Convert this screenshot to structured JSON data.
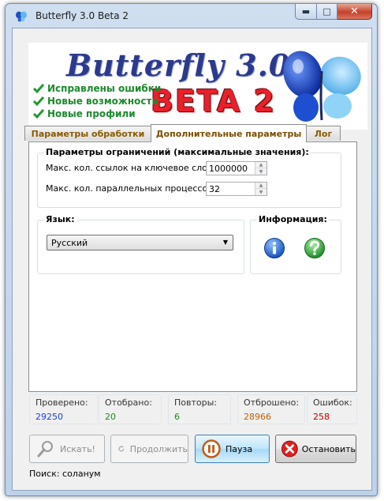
{
  "window": {
    "title": "Butterfly 3.0 Beta 2"
  },
  "banner": {
    "title": "Butterfly 3.0",
    "beta": "BETA 2",
    "features": [
      "Исправлены ошибки",
      "Новые возможности",
      "Новые профили"
    ]
  },
  "tabs": [
    {
      "label": "Параметры обработки",
      "active": false
    },
    {
      "label": "Дополнительные параметры",
      "active": true
    },
    {
      "label": "Лог",
      "active": false
    }
  ],
  "limits": {
    "group_label": "Параметры ограничений (максимальные значения):",
    "links_label": "Макс. кол. ссылок на ключевое слово:",
    "links_value": "1000000",
    "threads_label": "Макс. кол. параллельных процессов:",
    "threads_value": "32"
  },
  "language": {
    "group_label": "Язык:",
    "selected": "Русский"
  },
  "info": {
    "group_label": "Информация:"
  },
  "stats": [
    {
      "label": "Проверено:",
      "value": "29250",
      "color": "#1a3fd8"
    },
    {
      "label": "Отобрано:",
      "value": "20",
      "color": "#1e8a1e"
    },
    {
      "label": "Повторы:",
      "value": "6",
      "color": "#1e8a1e"
    },
    {
      "label": "Отброшено:",
      "value": "28966",
      "color": "#c06000"
    },
    {
      "label": "Ошибок:",
      "value": "258",
      "color": "#c00000"
    }
  ],
  "buttons": {
    "search": "Искать!",
    "continue": "Продолжить",
    "pause": "Пауза",
    "stop": "Остановить"
  },
  "status": {
    "text": "Поиск: соланум"
  }
}
